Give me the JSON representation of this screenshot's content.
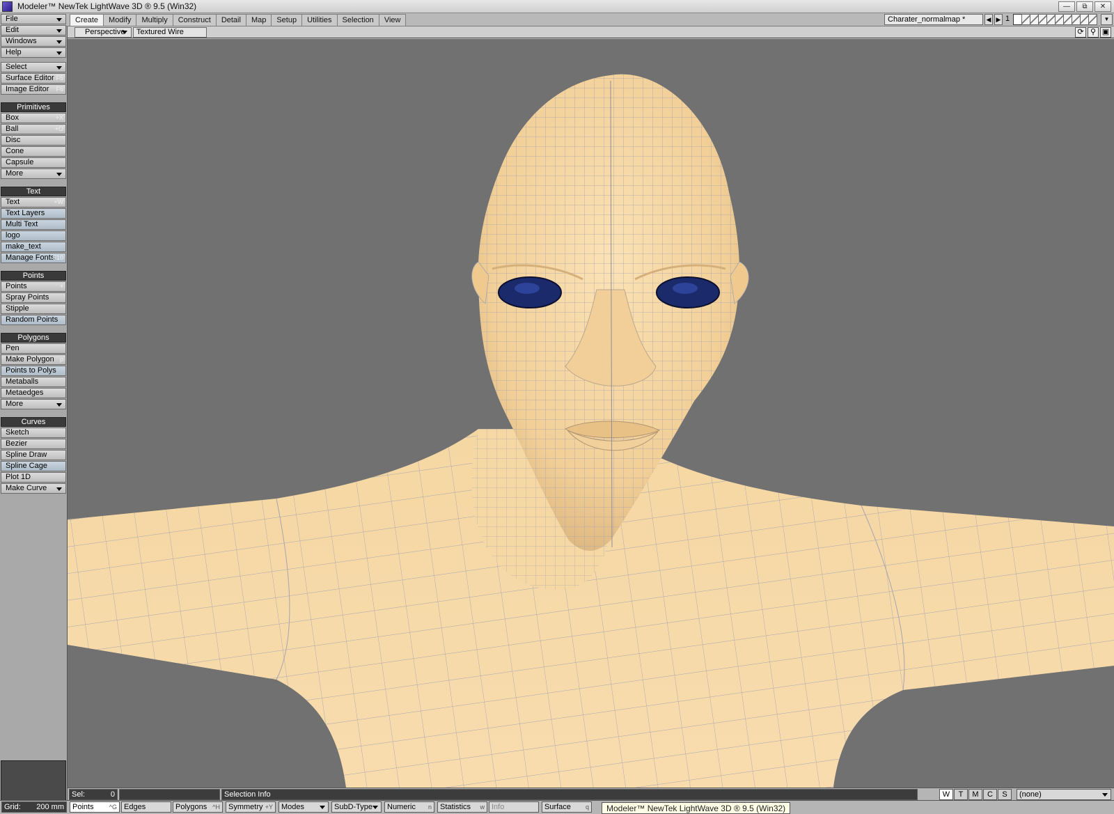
{
  "window": {
    "title": "Modeler™ NewTek LightWave 3D ® 9.5  (Win32)",
    "controls": [
      "—",
      "⧉",
      "✕"
    ]
  },
  "tabs": [
    "Create",
    "Modify",
    "Multiply",
    "Construct",
    "Detail",
    "Map",
    "Setup",
    "Utilities",
    "Selection",
    "View"
  ],
  "active_tab": "Create",
  "layers": {
    "object_name": "Charater_normalmap *",
    "current_layer": "1",
    "prev_icon": "chevron-left-icon",
    "next_icon": "chevron-right-icon"
  },
  "menus": {
    "file": "File",
    "edit": "Edit",
    "windows": "Windows",
    "help": "Help",
    "select": "Select",
    "surface_editor": "Surface Editor",
    "surface_editor_key": "F5",
    "image_editor": "Image Editor",
    "image_editor_key": "F6"
  },
  "primitives": {
    "header": "Primitives",
    "box": "Box",
    "box_key": "+X",
    "ball": "Ball",
    "ball_key": "+O",
    "disc": "Disc",
    "cone": "Cone",
    "capsule": "Capsule",
    "more": "More"
  },
  "text_group": {
    "header": "Text",
    "text": "Text",
    "text_key": "+W",
    "text_layers": "Text Layers",
    "multi_text": "Multi Text",
    "logo": "logo",
    "make_text": "make_text",
    "manage_fonts": "Manage Fonts",
    "manage_fonts_key": "F10"
  },
  "points_group": {
    "header": "Points",
    "points": "Points",
    "points_key": "+",
    "spray_points": "Spray Points",
    "stipple": "Stipple",
    "random_points": "Random Points"
  },
  "polygons_group": {
    "header": "Polygons",
    "pen": "Pen",
    "make_polygon": "Make Polygon",
    "make_polygon_key": "p",
    "points_to_polys": "Points to Polys",
    "metaballs": "Metaballs",
    "metaedges": "Metaedges",
    "more": "More"
  },
  "curves_group": {
    "header": "Curves",
    "sketch": "Sketch",
    "bezier": "Bezier",
    "spline_draw": "Spline Draw",
    "spline_cage": "Spline Cage",
    "plot_1d": "Plot 1D",
    "make_curve": "Make Curve"
  },
  "viewport": {
    "view_type": "Perspective",
    "render_mode": "Textured Wire",
    "icons": [
      "rotate-icon",
      "zoom-icon",
      "maximize-icon"
    ]
  },
  "statusbar": {
    "sel_label": "Sel:",
    "sel_value": "0",
    "selection_info": "Selection Info",
    "wtmcs": [
      "W",
      "T",
      "M",
      "C",
      "S"
    ],
    "surface_value": "(none)"
  },
  "bottombar": {
    "grid_label": "Grid:",
    "grid_value": "200 mm",
    "points": "Points",
    "points_key": "^G",
    "edges": "Edges",
    "polygons": "Polygons",
    "polygons_key": "^H",
    "symmetry": "Symmetry",
    "symmetry_key": "+Y",
    "modes": "Modes",
    "subd_type": "SubD-Type",
    "numeric": "Numeric",
    "numeric_key": "n",
    "statistics": "Statistics",
    "statistics_key": "w",
    "info": "Info",
    "surface": "Surface",
    "surface_key": "q"
  },
  "tooltip": "Modeler™ NewTek LightWave 3D ® 9.5  (Win32)",
  "colors": {
    "viewport_bg": "#717171",
    "skin": "#f3d3a0",
    "eye": "#1c2b6e",
    "wire": "#9a9aa6"
  }
}
